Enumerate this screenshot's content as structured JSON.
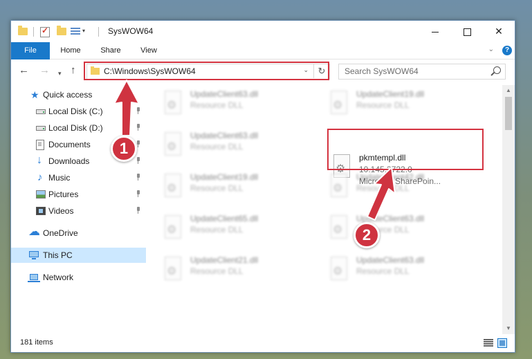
{
  "window": {
    "title": "SysWOW64",
    "controls": {
      "minimize": "",
      "maximize": "",
      "close": "✕"
    }
  },
  "ribbon": {
    "tabs": [
      {
        "label": "File",
        "active": true
      },
      {
        "label": "Home"
      },
      {
        "label": "Share"
      },
      {
        "label": "View"
      }
    ],
    "help": "?"
  },
  "address_bar": {
    "path": "C:\\Windows\\SysWOW64",
    "refresh_glyph": "↻"
  },
  "search": {
    "placeholder": "Search SysWOW64"
  },
  "navigation": {
    "back": "←",
    "forward": "→",
    "recent": "▾",
    "up": "↑"
  },
  "sidebar": {
    "items": [
      {
        "label": "Quick access",
        "icon": "star-icon",
        "pinned": false
      },
      {
        "label": "Local Disk (C:)",
        "icon": "drive-icon",
        "pinned": true
      },
      {
        "label": "Local Disk (D:)",
        "icon": "drive-icon",
        "pinned": true
      },
      {
        "label": "Documents",
        "icon": "documents-icon",
        "pinned": true
      },
      {
        "label": "Downloads",
        "icon": "downloads-icon",
        "pinned": true
      },
      {
        "label": "Music",
        "icon": "music-icon",
        "pinned": true
      },
      {
        "label": "Pictures",
        "icon": "pictures-icon",
        "pinned": true
      },
      {
        "label": "Videos",
        "icon": "videos-icon",
        "pinned": true
      },
      {
        "label": "OneDrive",
        "icon": "onedrive-icon",
        "pinned": false
      },
      {
        "label": "This PC",
        "icon": "this-pc-icon",
        "pinned": false,
        "selected": true
      },
      {
        "label": "Network",
        "icon": "network-icon",
        "pinned": false
      }
    ]
  },
  "files": {
    "left": [
      {
        "name": "UpdateClient63.dll",
        "type": "Resource DLL"
      },
      {
        "name": "UpdateClient63.dll",
        "type": "Resource DLL"
      },
      {
        "name": "UpdateClient19.dll",
        "type": "Resource DLL"
      },
      {
        "name": "UpdateClient65.dll",
        "type": "Resource DLL"
      },
      {
        "name": "UpdateClient21.dll",
        "type": "Resource DLL"
      }
    ],
    "right": [
      {
        "name": "UpdateClient19.dll",
        "type": "Resource DLL"
      },
      {
        "name": "pkmtempl.dll",
        "version": "10.145.3722.0",
        "company": "Microsoft SharePoin..."
      },
      {
        "name": "UpdateClient42.dll",
        "type": "Resource DLL"
      },
      {
        "name": "UpdateClient63.dll",
        "type": "Resource DLL"
      },
      {
        "name": "UpdateClient63.dll",
        "type": "Resource DLL"
      }
    ]
  },
  "status": {
    "item_count": "181 items"
  },
  "annotations": {
    "step1": "1",
    "step2": "2"
  },
  "colors": {
    "accent": "#1979ca",
    "highlight": "#d43340",
    "selection": "#cce8ff"
  }
}
